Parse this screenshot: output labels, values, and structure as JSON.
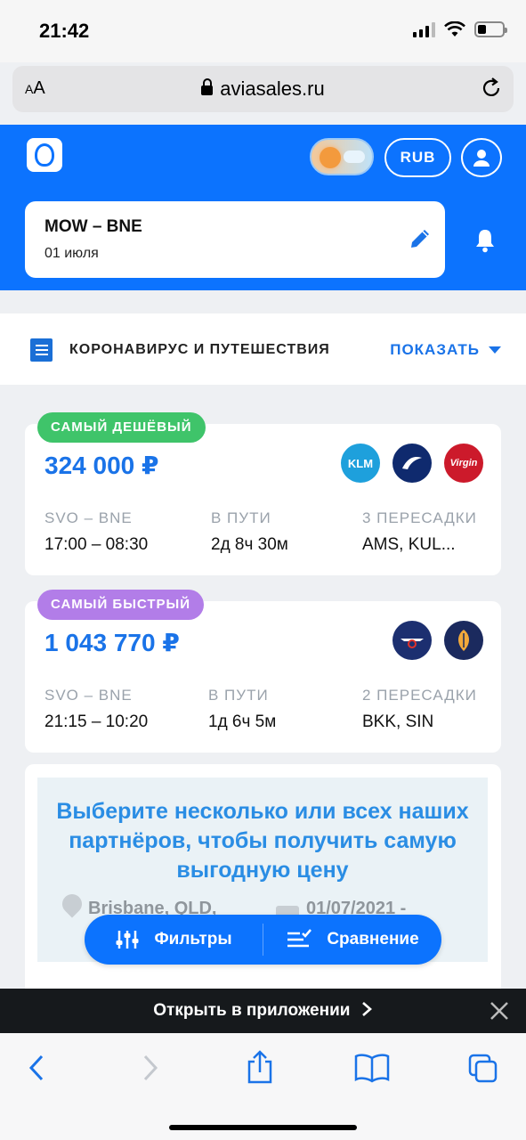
{
  "status_bar": {
    "time": "21:42"
  },
  "browser": {
    "aa_label": "AA",
    "url": "aviasales.ru"
  },
  "header": {
    "currency": "RUB",
    "search": {
      "route": "MOW – BNE",
      "date": "01 июля"
    }
  },
  "corona_banner": {
    "title": "КОРОНАВИРУС И ПУТЕШЕСТВИЯ",
    "action": "ПОКАЗАТЬ"
  },
  "results": [
    {
      "badge": "САМЫЙ ДЕШЁВЫЙ",
      "badge_color": "#3fc46a",
      "price": "324 000 ₽",
      "airlines": [
        "KLM",
        "Malaysia Airlines",
        "Virgin Australia"
      ],
      "route": "SVO – BNE",
      "time": "17:00 – 08:30",
      "duration_label": "В ПУТИ",
      "duration": "2д 8ч 30м",
      "stops_label": "3 ПЕРЕСАДКИ",
      "stops": "AMS, KUL..."
    },
    {
      "badge": "САМЫЙ БЫСТРЫЙ",
      "badge_color": "#b27de8",
      "price": "1 043 770 ₽",
      "airlines": [
        "Aeroflot",
        "Singapore Airlines"
      ],
      "route": "SVO – BNE",
      "time": "21:15 – 10:20",
      "duration_label": "В ПУТИ",
      "duration": "1д 6ч 5м",
      "stops_label": "2 ПЕРЕСАДКИ",
      "stops": "BKK, SIN"
    }
  ],
  "partners": {
    "headline": "Выберите несколько или всех наших партнёров, чтобы получить самую выгодную цену",
    "city": "Brisbane, QLD,",
    "date": "01/07/2021 -"
  },
  "floating_bar": {
    "filters": "Фильтры",
    "compare": "Сравнение"
  },
  "app_banner": {
    "text": "Открыть в приложении"
  },
  "colors": {
    "brand_blue": "#0c73fe",
    "price_blue": "#1a73e8"
  }
}
